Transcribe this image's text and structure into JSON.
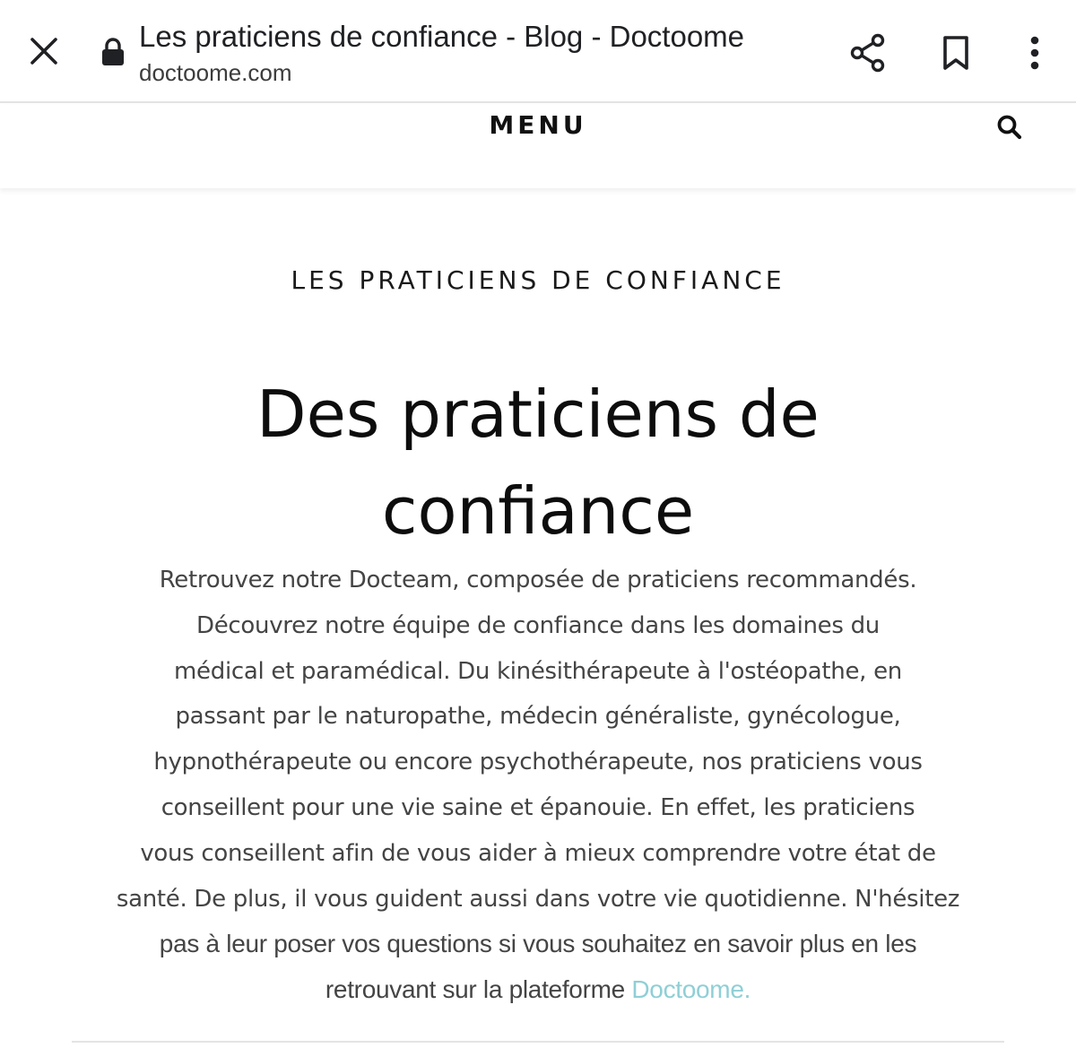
{
  "browser": {
    "page_title": "Les praticiens de confiance - Blog - Doctoome",
    "url": "doctoome.com",
    "icons": {
      "close": "close-icon",
      "lock": "lock-icon",
      "share": "share-icon",
      "bookmark": "bookmark-icon",
      "more": "more-vert-icon"
    }
  },
  "header": {
    "menu_label": "MENU",
    "search_icon": "search-icon"
  },
  "article": {
    "category": "LES PRATICIENS DE CONFIANCE",
    "title_line1": "Des praticiens de",
    "title_line2": "confiance",
    "body_lines": [
      "Retrouvez notre Docteam, composée de praticiens recommandés.",
      "Découvrez notre équipe de confiance dans les domaines du",
      "médical et paramédical. Du kinésithérapeute à l'ostéopathe, en",
      "passant par le naturopathe, médecin généraliste, gynécologue,",
      "hypnothérapeute ou encore psychothérapeute, nos praticiens vous",
      "conseillent pour une vie saine et épanouie. En effet, les praticiens",
      "vous conseillent afin de vous aider à mieux comprendre votre état de",
      "santé. De plus, il vous guident aussi dans votre vie quotidienne. N'hésitez",
      "pas à leur poser vos questions si vous souhaitez en savoir plus en les",
      "retrouvant sur la plateforme "
    ],
    "link_text": "Doctoome.",
    "link_color": "#8fcfd6"
  }
}
